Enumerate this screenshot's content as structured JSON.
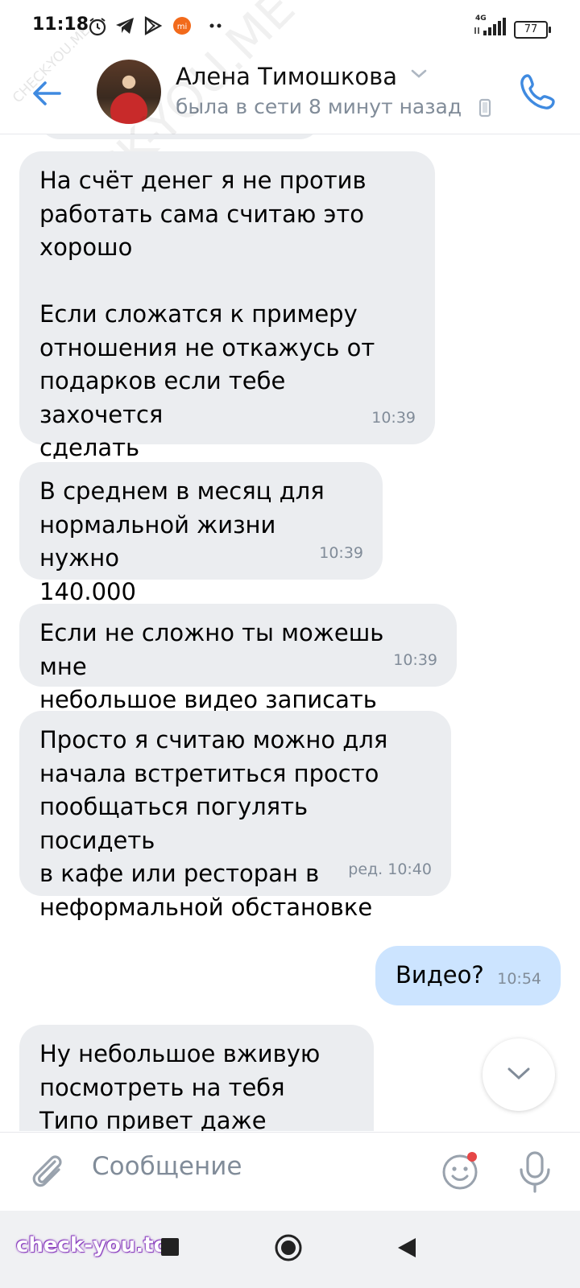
{
  "status_bar": {
    "time": "11:18",
    "icons": [
      "alarm-icon",
      "telegram-icon",
      "play-store-icon",
      "mi-icon",
      "more-dots-icon"
    ],
    "signal": "4G",
    "battery": "77"
  },
  "header": {
    "name": "Алена Тимошкова",
    "status": "была в сети 8 минут назад"
  },
  "messages": [
    {
      "direction": "in",
      "text": "На счёт денег я не против\nработать сама считаю это\nхорошо\n\nЕсли сложатся к примеру\nотношения не откажусь от\nподарков если тебе захочется\nсделать",
      "time": "10:39"
    },
    {
      "direction": "in",
      "text": "В среднем в месяц для\nнормальной жизни нужно\n140.000",
      "time": "10:39"
    },
    {
      "direction": "in",
      "text": "Если не сложно ты можешь мне\nнебольшое видео записать",
      "time": "10:39"
    },
    {
      "direction": "in",
      "text": "Просто я считаю можно для\nначала встретиться просто\nпообщаться погулять посидеть\nв кафе или ресторан в\nнеформальной обстановке",
      "time": "ред. 10:40"
    },
    {
      "direction": "out",
      "text": "Видео?",
      "time": "10:54"
    },
    {
      "direction": "in",
      "text": "Ну небольшое вживую\nпосмотреть на тебя\nТипо привет даже можно",
      "time": ""
    }
  ],
  "composer": {
    "placeholder": "Сообщение"
  },
  "watermark": {
    "diagonal": "CHECK-YOU.ME",
    "bottom": "check-you.to"
  },
  "colors": {
    "accent": "#3f8ae0",
    "incoming_bubble": "#ebedf0",
    "outgoing_bubble": "#cce4ff",
    "secondary_text": "#818c99",
    "notification_dot": "#e64646"
  }
}
